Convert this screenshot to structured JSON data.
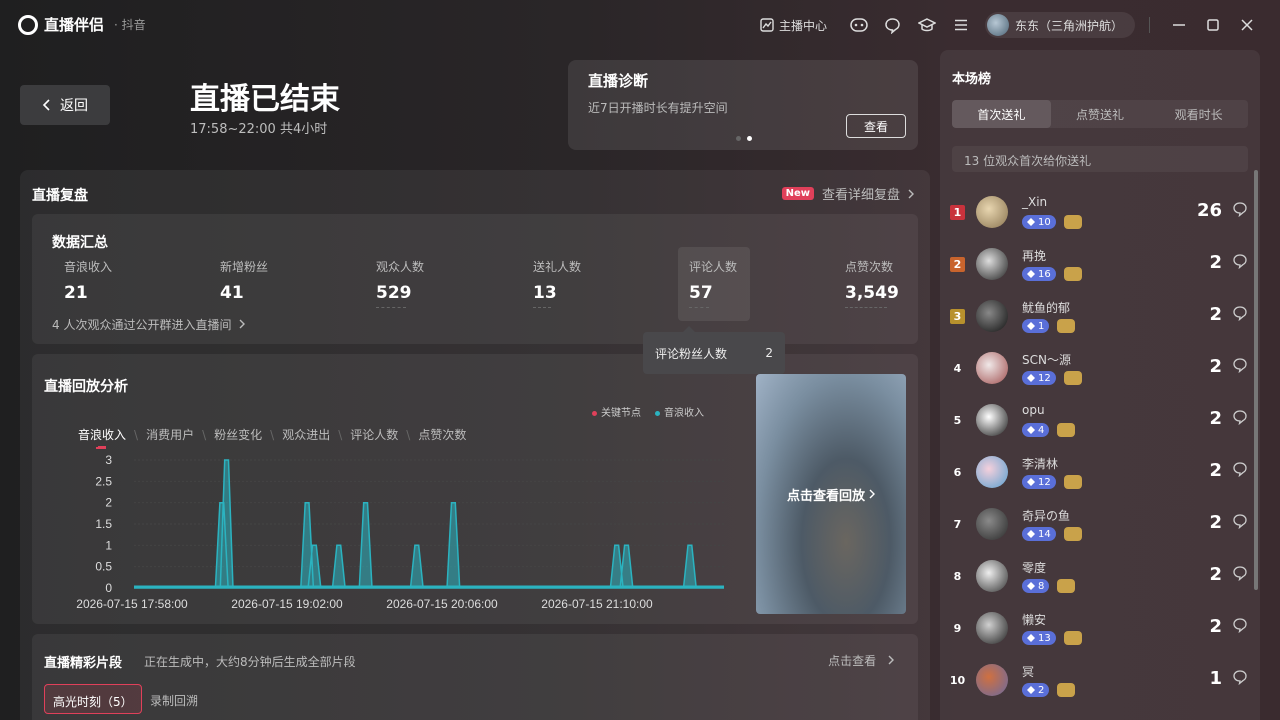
{
  "app": {
    "name": "直播伴侣",
    "sub": "· 抖音"
  },
  "topbar": {
    "streamer_center": "主播中心",
    "user": "东东（三角洲护航）"
  },
  "header": {
    "back": "返回",
    "title": "直播已结束",
    "time": "17:58~22:00 共4小时"
  },
  "diagnosis": {
    "title": "直播诊断",
    "desc": "近7日开播时长有提升空间",
    "button": "查看"
  },
  "review": {
    "title": "直播复盘",
    "badge": "New",
    "link": "查看详细复盘"
  },
  "summary": {
    "title": "数据汇总",
    "stats": [
      {
        "label": "音浪收入",
        "value": "21"
      },
      {
        "label": "新增粉丝",
        "value": "41"
      },
      {
        "label": "观众人数",
        "value": "529"
      },
      {
        "label": "送礼人数",
        "value": "13"
      },
      {
        "label": "评论人数",
        "value": "57"
      },
      {
        "label": "点赞次数",
        "value": "3,549"
      }
    ],
    "note": "4 人次观众通过公开群进入直播间"
  },
  "tooltip": {
    "label": "评论粉丝人数",
    "value": "2"
  },
  "replay": {
    "title": "直播回放分析",
    "legend": [
      {
        "name": "关键节点",
        "color": "#e0405a"
      },
      {
        "name": "音浪收入",
        "color": "#2bb3c0"
      }
    ],
    "tabs": [
      "音浪收入",
      "消费用户",
      "粉丝变化",
      "观众进出",
      "评论人数",
      "点赞次数"
    ],
    "video_label": "点击查看回放"
  },
  "chart_data": {
    "type": "area",
    "y_ticks": [
      "3",
      "2.5",
      "2",
      "1.5",
      "1",
      "0.5",
      "0"
    ],
    "ylim": [
      0,
      3
    ],
    "x_ticks": [
      "2026-07-15 17:58:00",
      "2026-07-15 19:02:00",
      "2026-07-15 20:06:00",
      "2026-07-15 21:10:00"
    ],
    "x_range_min": [
      0,
      242
    ],
    "series": [
      {
        "name": "音浪收入",
        "color": "#2bb3c0",
        "spikes": [
          {
            "t": 36,
            "v": 2
          },
          {
            "t": 38,
            "v": 3
          },
          {
            "t": 71,
            "v": 2
          },
          {
            "t": 74,
            "v": 1
          },
          {
            "t": 84,
            "v": 1
          },
          {
            "t": 95,
            "v": 2
          },
          {
            "t": 116,
            "v": 1
          },
          {
            "t": 131,
            "v": 2
          },
          {
            "t": 198,
            "v": 1
          },
          {
            "t": 202,
            "v": 1
          },
          {
            "t": 228,
            "v": 1
          }
        ]
      }
    ]
  },
  "clips": {
    "title": "直播精彩片段",
    "desc": "正在生成中，大约8分钟后生成全部片段",
    "link": "点击查看",
    "tab1": "高光时刻（5）",
    "tab2": "录制回溯"
  },
  "ranking": {
    "title": "本场榜",
    "tabs": [
      "首次送礼",
      "点赞送礼",
      "观看时长"
    ],
    "note": "13 位观众首次给你送礼",
    "rows": [
      {
        "rank": "1",
        "name": "_Xin",
        "level": "10",
        "count": "26"
      },
      {
        "rank": "2",
        "name": "再挽",
        "level": "16",
        "count": "2"
      },
      {
        "rank": "3",
        "name": "鱿鱼的郁",
        "level": "1",
        "count": "2"
      },
      {
        "rank": "4",
        "name": "SCN～源",
        "level": "12",
        "count": "2"
      },
      {
        "rank": "5",
        "name": "opu",
        "level": "4",
        "count": "2"
      },
      {
        "rank": "6",
        "name": "李清林",
        "level": "12",
        "count": "2"
      },
      {
        "rank": "7",
        "name": "奇异の鱼",
        "level": "14",
        "count": "2"
      },
      {
        "rank": "8",
        "name": "零度",
        "level": "8",
        "count": "2"
      },
      {
        "rank": "9",
        "name": "懒安",
        "level": "13",
        "count": "2"
      },
      {
        "rank": "10",
        "name": "冥",
        "level": "2",
        "count": "1"
      }
    ]
  }
}
